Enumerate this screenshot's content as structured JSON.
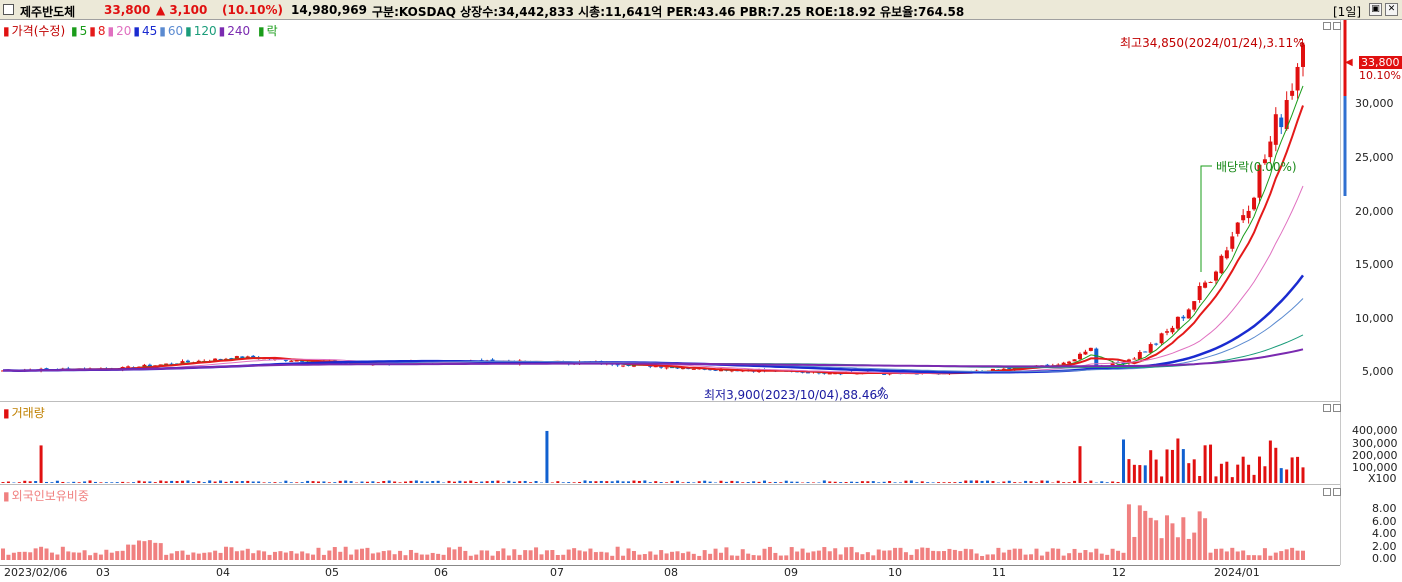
{
  "header": {
    "name": "제주반도체",
    "price": "33,800",
    "change": "▲ 3,100",
    "change_pct": "(10.10%)",
    "volume": "14,980,969",
    "info": "구분:KOSDAQ 상장수:34,442,833 시총:11,641억 PER:43.46 PBR:7.25 ROE:18.92 유보율:764.58",
    "period": "[1일]"
  },
  "legend_price": {
    "prefix": "가격(수정)",
    "ma": [
      {
        "label": "5",
        "color": "#1a9c1a"
      },
      {
        "label": "8",
        "color": "#e41a1a"
      },
      {
        "label": "20",
        "color": "#e070c0"
      },
      {
        "label": "45",
        "color": "#1a2bd0"
      },
      {
        "label": "60",
        "color": "#5a8ad0"
      },
      {
        "label": "120",
        "color": "#1a9c7a"
      },
      {
        "label": "240",
        "color": "#7a2ab0"
      }
    ],
    "drop": "락"
  },
  "legend_volume": "거래량",
  "legend_foreign": "외국인보유비중",
  "annotations": {
    "high": "최고34,850(2024/01/24),3.11%",
    "low": "최저3,900(2023/10/04),88.46%",
    "dividend": "배당락(0.00%)"
  },
  "price_axis": {
    "current": "33,800",
    "current_pct": "10.10%",
    "ticks": [
      "30,000",
      "25,000",
      "20,000",
      "15,000",
      "10,000",
      "5,000"
    ]
  },
  "volume_axis": {
    "ticks": [
      "400,000",
      "300,000",
      "200,000",
      "100,000"
    ],
    "unit": "X100"
  },
  "foreign_axis": {
    "ticks": [
      "8.00",
      "6.00",
      "4.00",
      "2.00",
      "0.00"
    ]
  },
  "x_axis": [
    "2023/02/06",
    "03",
    "04",
    "05",
    "06",
    "07",
    "08",
    "09",
    "10",
    "11",
    "12",
    "2024/01"
  ],
  "colors": {
    "up": "#e01010",
    "down": "#1060d0",
    "header_bg": "#ece9d8",
    "foreign_bar": "#f08080"
  },
  "chart_data": [
    {
      "type": "candlestick",
      "title": "가격(수정)",
      "x": [
        "2023/02",
        "2023/03",
        "2023/04",
        "2023/05",
        "2023/06",
        "2023/07",
        "2023/08",
        "2023/09",
        "2023/10",
        "2023/11",
        "2023/12",
        "2024/01"
      ],
      "close_approx": [
        4400,
        4600,
        5600,
        5000,
        5200,
        5100,
        4500,
        4200,
        4100,
        5000,
        12500,
        33800
      ],
      "high": {
        "value": 34850,
        "date": "2024/01/24"
      },
      "low": {
        "value": 3900,
        "date": "2023/10/04"
      },
      "ylim": [
        3000,
        36000
      ]
    },
    {
      "type": "bar",
      "title": "거래량",
      "unit": "X100",
      "ylim": [
        0,
        450000
      ]
    },
    {
      "type": "bar",
      "title": "외국인보유비중",
      "ylim": [
        0,
        9
      ]
    }
  ]
}
